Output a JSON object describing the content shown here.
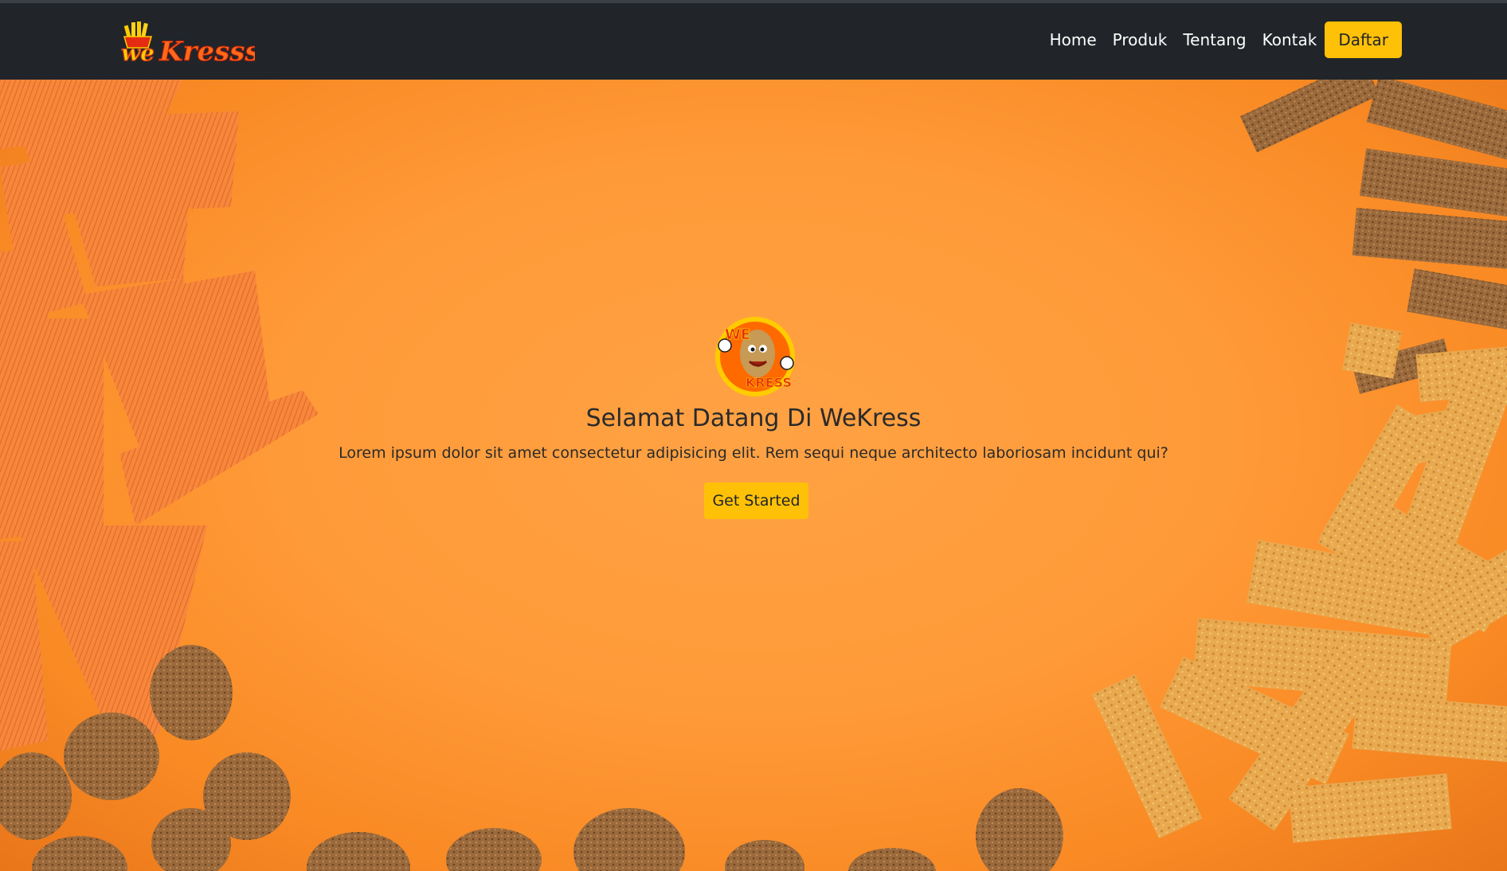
{
  "navbar": {
    "brand_text": "weKresss",
    "links": [
      "Home",
      "Produk",
      "Tentang",
      "Kontak"
    ],
    "cta_label": "Daftar"
  },
  "hero": {
    "logo_text": "WE KRESS",
    "title": "Selamat Datang Di WeKress",
    "text": "Lorem ipsum dolor sit amet consectetur adipisicing elit. Rem sequi neque architecto laboriosam incidunt qui?",
    "button_label": "Get Started"
  },
  "colors": {
    "navbar_bg": "#212529",
    "accent": "#ffc107",
    "hero_bg": "#ff9a38",
    "text": "#2a2a2a"
  },
  "icons": {
    "brand": "wekresss-logo-icon",
    "hero_logo": "mascot-logo-icon"
  }
}
